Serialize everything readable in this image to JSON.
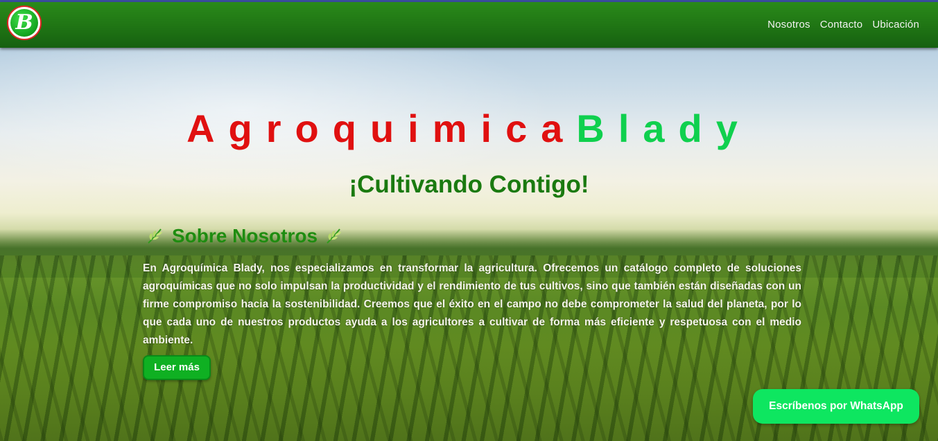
{
  "navbar": {
    "logo_letter": "B",
    "links": [
      "Nosotros",
      "Contacto",
      "Ubicación"
    ]
  },
  "hero": {
    "title_part1": "Agroquimica",
    "title_part2": "Blady",
    "subtitle": "¡Cultivando Contigo!",
    "about_heading": "Sobre Nosotros",
    "about_text": "En Agroquímica Blady, nos especializamos en transformar la agricultura. Ofrecemos un catálogo completo de soluciones agroquímicas que no solo impulsan la productividad y el rendimiento de tus cultivos, sino que también están diseñadas con un firme compromiso hacia la sostenibilidad. Creemos que el éxito en el campo no debe comprometer la salud del planeta, por lo que cada uno de nuestros productos ayuda a los agricultores a cultivar de forma más eficiente y respetuosa con el medio ambiente.",
    "read_more_label": "Leer más"
  },
  "whatsapp": {
    "label": "Escríbenos por WhatsApp"
  },
  "colors": {
    "nav_green": "#1f7414",
    "title_red": "#e01010",
    "title_green": "#0fd04e",
    "subtitle_green": "#1a7a10",
    "button_green": "#0fb022",
    "whatsapp_green": "#0ee660"
  },
  "icons": [
    "logo-icon",
    "leaf-icon"
  ]
}
